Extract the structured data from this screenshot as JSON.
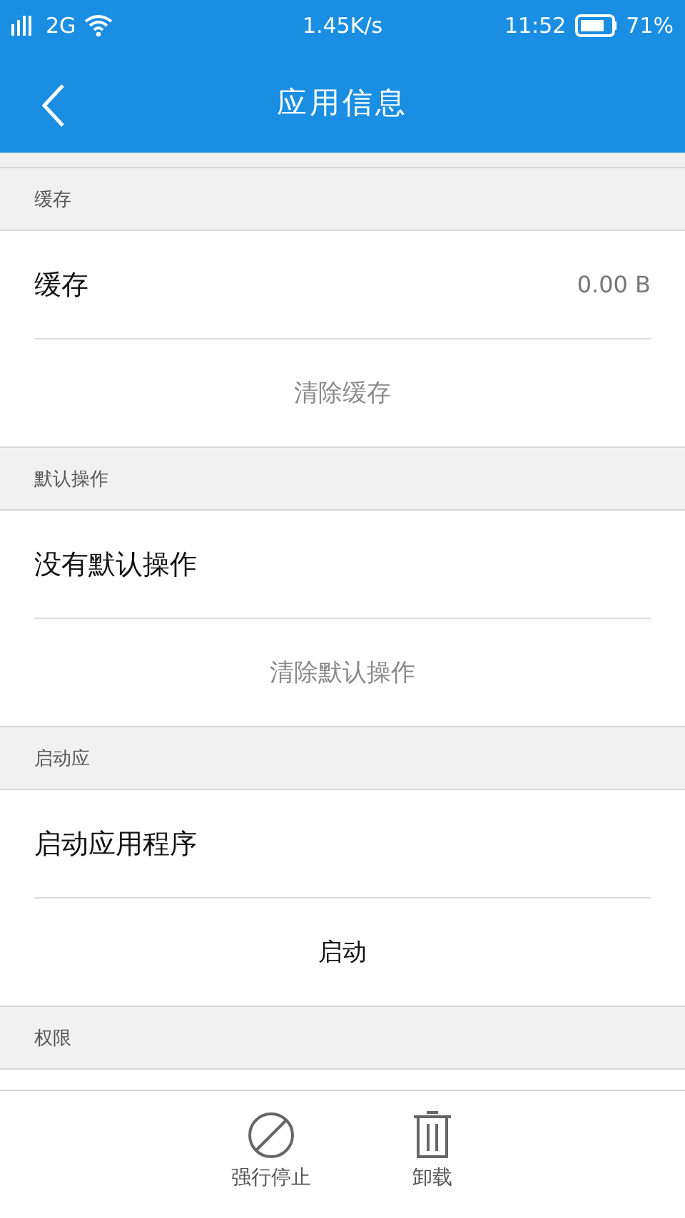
{
  "status_bar": {
    "network": "2G",
    "speed": "1.45K/s",
    "time": "11:52",
    "battery": "71%"
  },
  "app_bar": {
    "title": "应用信息"
  },
  "sections": [
    {
      "header": "缓存",
      "row": {
        "label": "缓存",
        "value": "0.00 B"
      },
      "action": {
        "label": "清除缓存",
        "disabled": true
      }
    },
    {
      "header": "默认操作",
      "row": {
        "label": "没有默认操作"
      },
      "action": {
        "label": "清除默认操作",
        "disabled": true
      }
    },
    {
      "header": "启动应",
      "row": {
        "label": "启动应用程序"
      },
      "action": {
        "label": "启动",
        "disabled": false
      }
    },
    {
      "header": "权限"
    }
  ],
  "bottom_actions": [
    {
      "kind": "stop",
      "label": "强行停止"
    },
    {
      "kind": "trash",
      "label": "卸载"
    }
  ]
}
